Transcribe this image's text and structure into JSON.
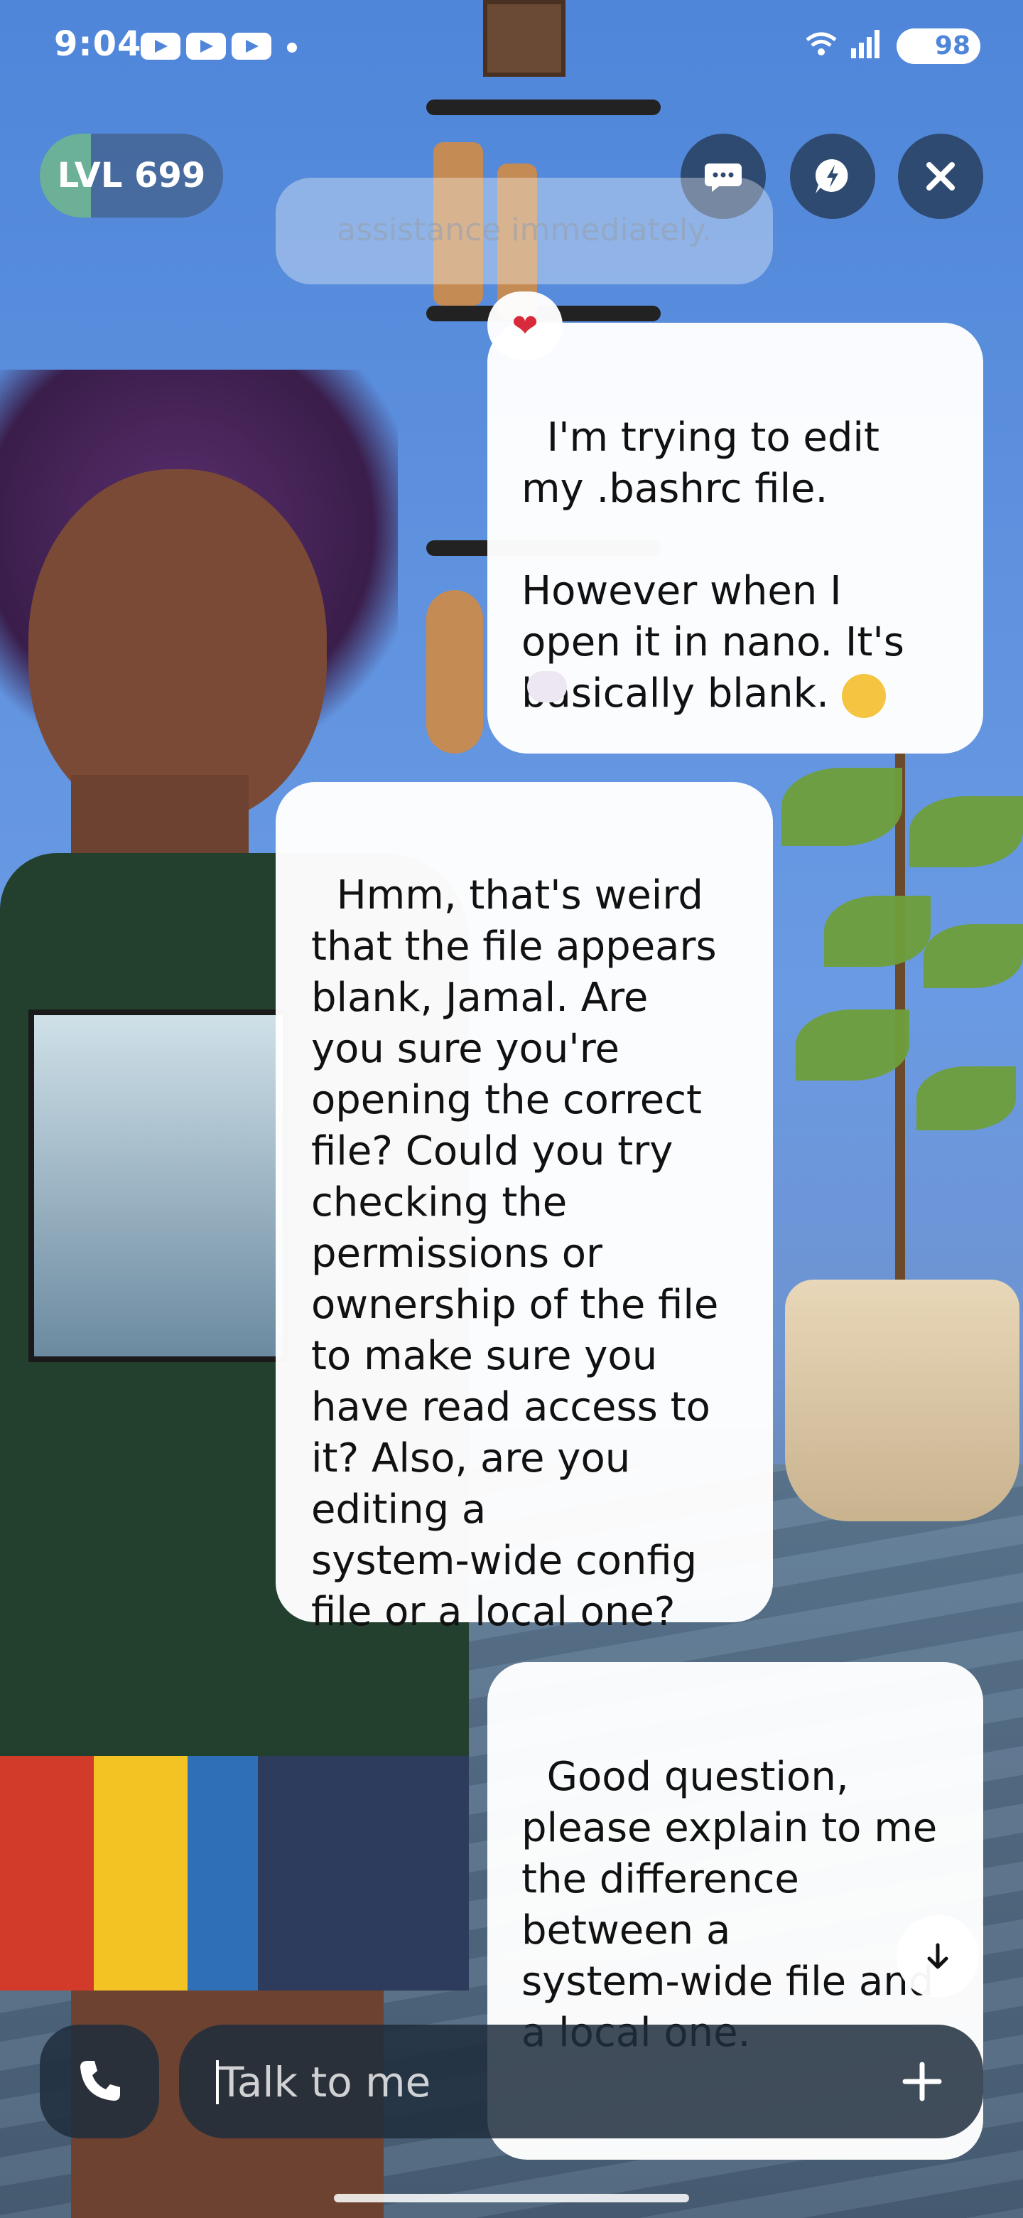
{
  "status_bar": {
    "time": "9:04",
    "battery": "98",
    "network": "6"
  },
  "level": {
    "label": "LVL 699",
    "progress_fraction": 0.28
  },
  "top_buttons": [
    "chat-bubble-icon",
    "chat-bolt-icon",
    "close-icon"
  ],
  "chat": {
    "faded_message": "assistance immediately.",
    "messages": [
      {
        "role": "user",
        "text": "I'm trying to edit\nmy .bashrc file.\n\nHowever when I\nopen it in nano. It's\nbasically blank. ",
        "reaction": "heart"
      },
      {
        "role": "assistant",
        "text": "Hmm, that's weird\nthat the file appears\nblank, Jamal. Are\nyou sure you're\nopening the correct\nfile? Could you try\nchecking the\npermissions or\nownership of the file\nto make sure you\nhave read access to\nit? Also, are you\nediting a\nsystem-wide config\nfile or a local one?"
      },
      {
        "role": "user",
        "text": "Good question,\nplease explain to me\nthe difference\nbetween a\nsystem-wide file and\na local one."
      }
    ]
  },
  "composer": {
    "placeholder": "Talk to me"
  },
  "colors": {
    "bubble": "#ffffff",
    "control_bg": "#2f4a70",
    "heart": "#d82a3a"
  }
}
